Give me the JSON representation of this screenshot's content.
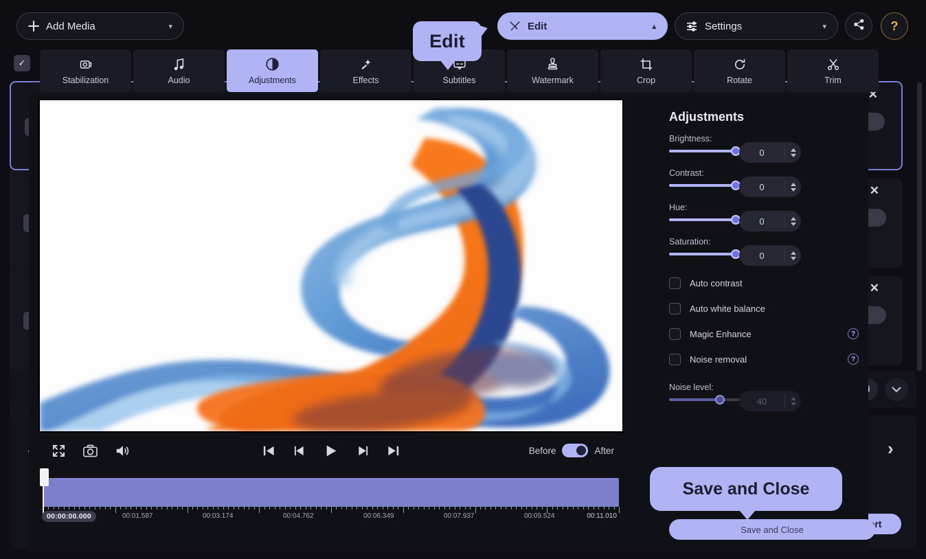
{
  "app": {
    "accent": "#b0b4f5",
    "bg": "#0d0d12",
    "panel_bg": "#101017"
  },
  "toolbar": {
    "add_media": "Add Media",
    "add_media_icon": "plus-icon",
    "add_media_caret": "▾",
    "edit": "Edit",
    "edit_icon": "tools-icon",
    "edit_caret": "▴",
    "settings": "Settings",
    "settings_icon": "sliders-icon",
    "settings_caret": "▾",
    "share_icon": "share-icon",
    "help_icon": "question-icon",
    "help_label": "?"
  },
  "tooltips": {
    "edit": "Edit",
    "save_and_close": "Save and Close"
  },
  "tabs": [
    {
      "label": "Stabilization",
      "icon": "stabilization-icon",
      "active": false
    },
    {
      "label": "Audio",
      "icon": "music-note-icon",
      "active": false
    },
    {
      "label": "Adjustments",
      "icon": "contrast-circle-icon",
      "active": true
    },
    {
      "label": "Effects",
      "icon": "magic-wand-icon",
      "active": false
    },
    {
      "label": "Subtitles",
      "icon": "subtitles-icon",
      "active": false
    },
    {
      "label": "Watermark",
      "icon": "stamp-icon",
      "active": false
    },
    {
      "label": "Crop",
      "icon": "crop-icon",
      "active": false
    },
    {
      "label": "Rotate",
      "icon": "rotate-icon",
      "active": false
    },
    {
      "label": "Trim",
      "icon": "scissors-icon",
      "active": false
    }
  ],
  "preview": {
    "player_icons": {
      "fullscreen": "fullscreen-icon",
      "snapshot": "camera-icon",
      "volume": "volume-icon",
      "skip_start": "skip-to-start-icon",
      "prev_frame": "previous-frame-icon",
      "play": "play-icon",
      "next_frame": "next-frame-icon",
      "skip_end": "skip-to-end-icon"
    },
    "before_label": "Before",
    "after_label": "After",
    "toggle_state": "After"
  },
  "timeline": {
    "current_time": "00:00:00.000",
    "ruler_labels": [
      "00:01.587",
      "00:03.174",
      "00:04.762",
      "00:06.349",
      "00:07.937",
      "00:09.524",
      "00:11.010"
    ]
  },
  "adjustments": {
    "title": "Adjustments",
    "sliders": [
      {
        "label": "Brightness:",
        "value": "0",
        "pos": 52
      },
      {
        "label": "Contrast:",
        "value": "0",
        "pos": 52
      },
      {
        "label": "Hue:",
        "value": "0",
        "pos": 52
      },
      {
        "label": "Saturation:",
        "value": "0",
        "pos": 52
      }
    ],
    "checkboxes": [
      {
        "label": "Auto contrast",
        "checked": false,
        "help": false
      },
      {
        "label": "Auto white balance",
        "checked": false,
        "help": false
      },
      {
        "label": "Magic Enhance",
        "checked": false,
        "help": true
      },
      {
        "label": "Noise removal",
        "checked": false,
        "help": true
      }
    ],
    "noise": {
      "label": "Noise level:",
      "value": "40",
      "pos": 40,
      "disabled": true
    },
    "save_button": "Save and Close",
    "help_glyph": "?"
  },
  "background_app": {
    "convert_button": "Convert",
    "collapse_left_icon": "chevron-left-icon",
    "collapse_right_icon": "chevron-right-icon",
    "close_icon": "✕",
    "check_icon": "✓",
    "snapshot_icon": "image-snapshot-icon",
    "chevron_down_icon": "chevron-down-icon",
    "list_icon": "list-icon"
  }
}
